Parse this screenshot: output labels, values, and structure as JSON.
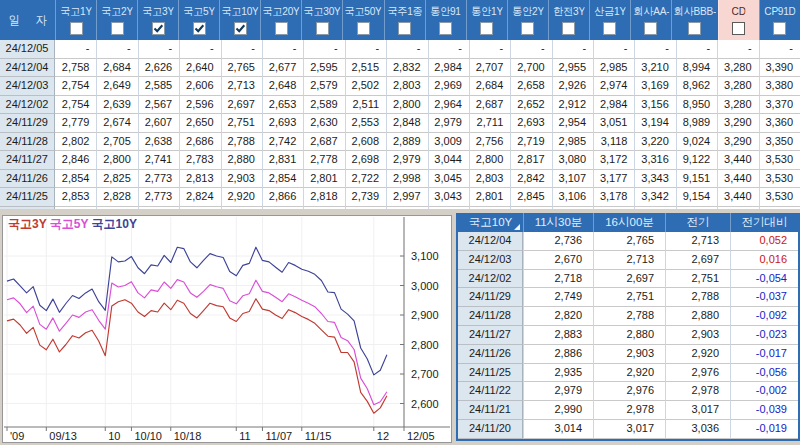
{
  "window": {
    "background": "#d4d0c8"
  },
  "grid": {
    "date_header": "일 자",
    "columns": [
      {
        "label": "국고1Y",
        "checked": false,
        "highlight": false
      },
      {
        "label": "국고2Y",
        "checked": false,
        "highlight": false
      },
      {
        "label": "국고3Y",
        "checked": true,
        "highlight": false
      },
      {
        "label": "국고5Y",
        "checked": true,
        "highlight": false
      },
      {
        "label": "국고10Y",
        "checked": true,
        "highlight": false
      },
      {
        "label": "국고20Y",
        "checked": false,
        "highlight": false
      },
      {
        "label": "국고30Y",
        "checked": false,
        "highlight": false
      },
      {
        "label": "국고50Y",
        "checked": false,
        "highlight": false
      },
      {
        "label": "국주1종",
        "checked": false,
        "highlight": false
      },
      {
        "label": "통안91",
        "checked": false,
        "highlight": false
      },
      {
        "label": "통안1Y",
        "checked": false,
        "highlight": false
      },
      {
        "label": "통안2Y",
        "checked": false,
        "highlight": false
      },
      {
        "label": "한전3Y",
        "checked": false,
        "highlight": false
      },
      {
        "label": "산금1Y",
        "checked": false,
        "highlight": false
      },
      {
        "label": "회사AA-",
        "checked": false,
        "highlight": false
      },
      {
        "label": "회사BBB-",
        "checked": false,
        "highlight": false
      },
      {
        "label": "CD",
        "checked": false,
        "highlight": true
      },
      {
        "label": "CP91D",
        "checked": false,
        "highlight": false
      }
    ],
    "rows": [
      {
        "date": "24/12/05",
        "values": [
          "-",
          "-",
          "-",
          "-",
          "-",
          "-",
          "-",
          "-",
          "-",
          "-",
          "-",
          "-",
          "-",
          "-",
          "-",
          "-",
          "-",
          "-"
        ]
      },
      {
        "date": "24/12/04",
        "values": [
          "2,758",
          "2,684",
          "2,626",
          "2,640",
          "2,765",
          "2,677",
          "2,595",
          "2,515",
          "2,832",
          "2,984",
          "2,707",
          "2,700",
          "2,955",
          "2,985",
          "3,210",
          "8,994",
          "3,280",
          "3,390"
        ]
      },
      {
        "date": "24/12/03",
        "values": [
          "2,754",
          "2,649",
          "2,585",
          "2,606",
          "2,713",
          "2,648",
          "2,579",
          "2,502",
          "2,803",
          "2,969",
          "2,684",
          "2,658",
          "2,926",
          "2,974",
          "3,169",
          "8,962",
          "3,280",
          "3,380"
        ]
      },
      {
        "date": "24/12/02",
        "values": [
          "2,754",
          "2,639",
          "2,567",
          "2,596",
          "2,697",
          "2,653",
          "2,589",
          "2,511",
          "2,800",
          "2,964",
          "2,687",
          "2,652",
          "2,912",
          "2,984",
          "3,156",
          "8,950",
          "3,280",
          "3,370"
        ]
      },
      {
        "date": "24/11/29",
        "values": [
          "2,779",
          "2,674",
          "2,607",
          "2,650",
          "2,751",
          "2,693",
          "2,630",
          "2,553",
          "2,848",
          "2,979",
          "2,711",
          "2,693",
          "2,954",
          "3,051",
          "3,194",
          "8,989",
          "3,290",
          "3,360"
        ]
      },
      {
        "date": "24/11/28",
        "values": [
          "2,802",
          "2,705",
          "2,638",
          "2,686",
          "2,788",
          "2,742",
          "2,687",
          "2,608",
          "2,889",
          "3,009",
          "2,756",
          "2,719",
          "2,985",
          "3,118",
          "3,220",
          "9,024",
          "3,290",
          "3,350"
        ]
      },
      {
        "date": "24/11/27",
        "values": [
          "2,846",
          "2,800",
          "2,741",
          "2,783",
          "2,880",
          "2,831",
          "2,778",
          "2,698",
          "2,979",
          "3,044",
          "2,800",
          "2,817",
          "3,080",
          "3,172",
          "3,316",
          "9,122",
          "3,440",
          "3,530"
        ]
      },
      {
        "date": "24/11/26",
        "values": [
          "2,854",
          "2,825",
          "2,773",
          "2,813",
          "2,903",
          "2,854",
          "2,801",
          "2,722",
          "2,998",
          "3,045",
          "2,803",
          "2,842",
          "3,107",
          "3,177",
          "3,343",
          "9,151",
          "3,440",
          "3,530"
        ]
      },
      {
        "date": "24/11/25",
        "values": [
          "2,853",
          "2,828",
          "2,773",
          "2,824",
          "2,920",
          "2,866",
          "2,818",
          "2,739",
          "2,997",
          "3,043",
          "2,801",
          "2,845",
          "3,106",
          "3,178",
          "3,342",
          "9,154",
          "3,440",
          "3,530"
        ]
      },
      {
        "date": "",
        "values": [
          "",
          "",
          "",
          "",
          "",
          "",
          "",
          "",
          "",
          "",
          "",
          "",
          "",
          "",
          "",
          "",
          "",
          ""
        ]
      }
    ]
  },
  "chart": {
    "legend": [
      {
        "label": "국고3Y",
        "color": "#c03a32"
      },
      {
        "label": "국고5Y",
        "color": "#d94fd6"
      },
      {
        "label": "국고10Y",
        "color": "#3d4397"
      }
    ],
    "y_axis": {
      "ticks": [
        {
          "value": 3.1,
          "label": "3,100"
        },
        {
          "value": 3.0,
          "label": "3,000"
        },
        {
          "value": 2.9,
          "label": "2,900"
        },
        {
          "value": 2.8,
          "label": "2,800"
        },
        {
          "value": 2.7,
          "label": "2,700"
        },
        {
          "value": 2.6,
          "label": "2,600"
        }
      ]
    },
    "x_axis": {
      "ticks": [
        {
          "label": "'09",
          "index": 0
        },
        {
          "label": "09/13",
          "index": 6
        },
        {
          "label": "10",
          "index": 15
        },
        {
          "label": "10/10",
          "index": 19
        },
        {
          "label": "10/18",
          "index": 25
        },
        {
          "label": "11",
          "index": 35
        },
        {
          "label": "11/07",
          "index": 39
        },
        {
          "label": "11/15",
          "index": 45
        },
        {
          "label": "12",
          "index": 56
        },
        {
          "label": "12/05",
          "index": 61
        }
      ]
    }
  },
  "chart_data": {
    "type": "line",
    "title": "",
    "xlabel": "",
    "ylabel": "",
    "ylim": [
      2.52,
      3.17
    ],
    "y_tick_labels": [
      "2,600",
      "2,700",
      "2,800",
      "2,900",
      "3,000",
      "3,100"
    ],
    "x_tick_labels": [
      "'09",
      "09/13",
      "10",
      "10/10",
      "10/18",
      "11",
      "11/07",
      "11/15",
      "12",
      "12/05"
    ],
    "legend_position": "top-left",
    "grid": true,
    "x": [
      "09/05",
      "09/06",
      "09/09",
      "09/10",
      "09/11",
      "09/12",
      "09/13",
      "09/19",
      "09/20",
      "09/23",
      "09/24",
      "09/25",
      "09/26",
      "09/27",
      "09/30",
      "10/02",
      "10/04",
      "10/07",
      "10/08",
      "10/10",
      "10/11",
      "10/14",
      "10/15",
      "10/16",
      "10/17",
      "10/18",
      "10/21",
      "10/22",
      "10/23",
      "10/24",
      "10/25",
      "10/28",
      "10/29",
      "10/30",
      "10/31",
      "11/01",
      "11/04",
      "11/05",
      "11/06",
      "11/07",
      "11/08",
      "11/11",
      "11/12",
      "11/13",
      "11/14",
      "11/15",
      "11/18",
      "11/19",
      "11/20",
      "11/21",
      "11/22",
      "11/25",
      "11/26",
      "11/27",
      "11/28",
      "11/29",
      "12/02",
      "12/03",
      "12/04"
    ],
    "series": [
      {
        "name": "국고3Y",
        "color": "#c03a32",
        "values": [
          2.88,
          2.886,
          2.866,
          2.838,
          2.858,
          2.798,
          2.782,
          2.818,
          2.775,
          2.8,
          2.83,
          2.822,
          2.84,
          2.848,
          2.812,
          2.762,
          2.93,
          2.945,
          2.952,
          2.94,
          2.91,
          2.895,
          2.915,
          2.91,
          2.94,
          2.918,
          2.95,
          2.94,
          2.905,
          2.89,
          2.915,
          2.94,
          2.932,
          2.928,
          2.89,
          2.878,
          2.905,
          2.912,
          2.955,
          2.92,
          2.915,
          2.9,
          2.888,
          2.918,
          2.908,
          2.895,
          2.885,
          2.872,
          2.85,
          2.828,
          2.825,
          2.773,
          2.773,
          2.741,
          2.638,
          2.607,
          2.567,
          2.585,
          2.626
        ]
      },
      {
        "name": "국고5Y",
        "color": "#d94fd6",
        "values": [
          2.952,
          2.958,
          2.938,
          2.908,
          2.93,
          2.868,
          2.852,
          2.89,
          2.845,
          2.872,
          2.9,
          2.892,
          2.91,
          2.918,
          2.882,
          2.852,
          3.008,
          2.995,
          3.0,
          3.013,
          2.975,
          2.958,
          2.985,
          2.98,
          3.012,
          2.99,
          3.02,
          3.012,
          2.975,
          2.96,
          2.98,
          3.003,
          2.996,
          2.99,
          2.948,
          2.938,
          2.965,
          2.972,
          3.018,
          2.98,
          2.975,
          2.96,
          2.945,
          2.972,
          2.962,
          2.95,
          2.94,
          2.928,
          2.905,
          2.878,
          2.875,
          2.824,
          2.813,
          2.783,
          2.686,
          2.65,
          2.596,
          2.606,
          2.64
        ]
      },
      {
        "name": "국고10Y",
        "color": "#3d4397",
        "values": [
          3.015,
          3.022,
          2.999,
          2.975,
          2.996,
          2.933,
          2.915,
          2.954,
          2.909,
          2.939,
          2.966,
          2.956,
          2.975,
          2.988,
          2.945,
          2.916,
          3.097,
          3.08,
          3.083,
          3.098,
          3.06,
          3.04,
          3.07,
          3.066,
          3.102,
          3.078,
          3.13,
          3.125,
          3.08,
          3.06,
          3.085,
          3.108,
          3.1,
          3.095,
          3.047,
          3.033,
          3.068,
          3.075,
          3.13,
          3.085,
          3.08,
          3.062,
          3.045,
          3.078,
          3.068,
          3.055,
          3.048,
          3.038,
          3.017,
          2.978,
          2.976,
          2.92,
          2.903,
          2.88,
          2.788,
          2.751,
          2.697,
          2.713,
          2.765
        ]
      }
    ]
  },
  "quote_table": {
    "headers": [
      "국고10Y",
      "11시30분",
      "16시00분",
      "전기",
      "전기대비"
    ],
    "rows": [
      {
        "date": "24/12/04",
        "t1130": "2,736",
        "t1600": "2,765",
        "prev": "2,713",
        "chg": "0,052",
        "dir": "up"
      },
      {
        "date": "24/12/03",
        "t1130": "2,670",
        "t1600": "2,713",
        "prev": "2,697",
        "chg": "0,016",
        "dir": "up"
      },
      {
        "date": "24/12/02",
        "t1130": "2,718",
        "t1600": "2,697",
        "prev": "2,751",
        "chg": "-0,054",
        "dir": "down"
      },
      {
        "date": "24/11/29",
        "t1130": "2,749",
        "t1600": "2,751",
        "prev": "2,788",
        "chg": "-0,037",
        "dir": "down"
      },
      {
        "date": "24/11/28",
        "t1130": "2,820",
        "t1600": "2,788",
        "prev": "2,880",
        "chg": "-0,092",
        "dir": "down"
      },
      {
        "date": "24/11/27",
        "t1130": "2,883",
        "t1600": "2,880",
        "prev": "2,903",
        "chg": "-0,023",
        "dir": "down"
      },
      {
        "date": "24/11/26",
        "t1130": "2,886",
        "t1600": "2,903",
        "prev": "2,920",
        "chg": "-0,017",
        "dir": "down"
      },
      {
        "date": "24/11/25",
        "t1130": "2,935",
        "t1600": "2,920",
        "prev": "2,976",
        "chg": "-0,056",
        "dir": "down"
      },
      {
        "date": "24/11/22",
        "t1130": "2,979",
        "t1600": "2,976",
        "prev": "2,978",
        "chg": "-0,002",
        "dir": "down"
      },
      {
        "date": "24/11/21",
        "t1130": "2,990",
        "t1600": "2,978",
        "prev": "3,017",
        "chg": "-0,039",
        "dir": "down"
      },
      {
        "date": "24/11/20",
        "t1130": "3,014",
        "t1600": "3,017",
        "prev": "3,036",
        "chg": "-0,019",
        "dir": "down"
      }
    ]
  },
  "colors": {
    "header_blue": "#2e6db4",
    "date_cell_bg": "#dce6ef",
    "highlight_pink": "#f8d6d2",
    "positive_red": "#cc1414",
    "negative_blue": "#1422cc",
    "line_3y": "#c03a32",
    "line_5y": "#d94fd6",
    "line_10y": "#3d4397"
  }
}
